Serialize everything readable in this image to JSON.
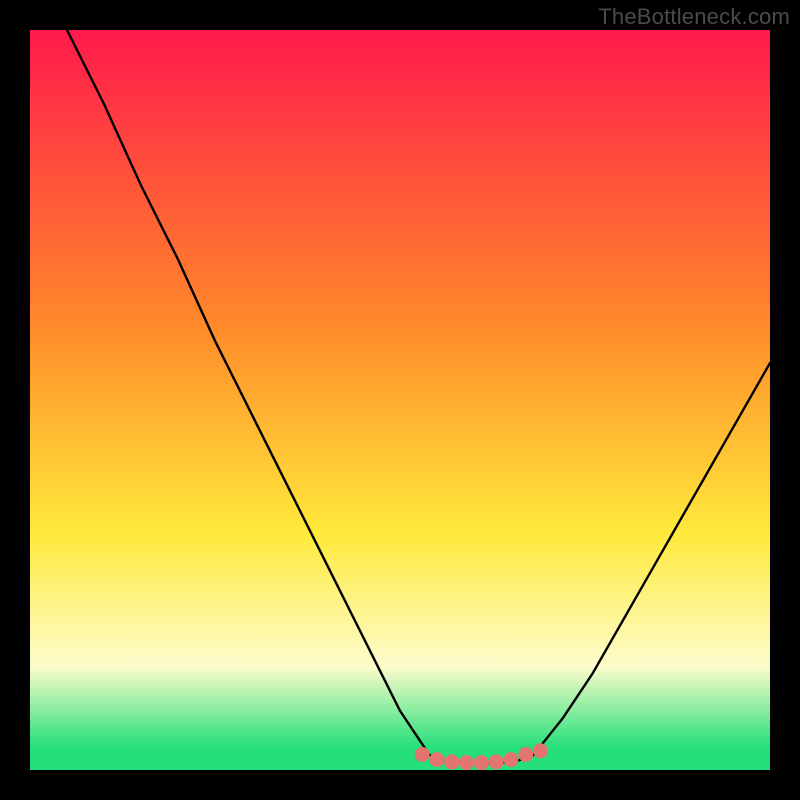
{
  "credit": "TheBottleneck.com",
  "colors": {
    "band_top": "#ff1a4b",
    "band_orange": "#ff8a2a",
    "band_yellow": "#ffe93b",
    "band_pale": "#fdfccc",
    "band_green": "#25e07a",
    "curve": "#000000",
    "marker": "#e3746f",
    "background": "#000000",
    "credit_text": "#4b4b4b"
  },
  "chart_data": {
    "type": "line",
    "title": "",
    "xlabel": "",
    "ylabel": "",
    "xlim": [
      0,
      100
    ],
    "ylim": [
      0,
      100
    ],
    "series": [
      {
        "name": "left-branch",
        "x": [
          5,
          10,
          15,
          20,
          25,
          30,
          35,
          40,
          45,
          50,
          54
        ],
        "y": [
          100,
          90,
          79,
          69,
          58,
          48,
          38,
          28,
          18,
          8,
          2
        ]
      },
      {
        "name": "right-branch",
        "x": [
          68,
          72,
          76,
          80,
          84,
          88,
          92,
          96,
          100
        ],
        "y": [
          2,
          7,
          13,
          20,
          27,
          34,
          41,
          48,
          55
        ]
      },
      {
        "name": "valley-floor",
        "x": [
          54,
          56,
          58,
          60,
          62,
          64,
          66,
          68
        ],
        "y": [
          2,
          1.3,
          1,
          0.9,
          0.9,
          1,
          1.3,
          2
        ]
      }
    ],
    "markers": {
      "name": "valley-dots",
      "x": [
        53,
        55,
        57,
        59,
        61,
        63,
        65,
        67,
        69
      ],
      "y": [
        2.1,
        1.4,
        1.1,
        1.0,
        1.0,
        1.1,
        1.4,
        2.1,
        2.6
      ]
    },
    "gradient_bands_pct_from_top": [
      {
        "stop": 0,
        "color": "band_top"
      },
      {
        "stop": 40,
        "color": "band_orange"
      },
      {
        "stop": 68,
        "color": "band_yellow"
      },
      {
        "stop": 86,
        "color": "band_pale"
      },
      {
        "stop": 97,
        "color": "band_green"
      },
      {
        "stop": 100,
        "color": "band_green"
      }
    ]
  }
}
